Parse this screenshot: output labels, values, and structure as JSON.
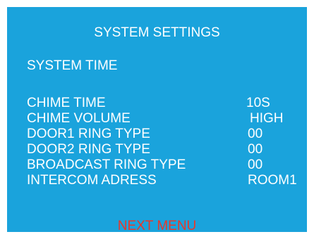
{
  "screen": {
    "title": "SYSTEM SETTINGS",
    "system_time_label": "SYSTEM TIME",
    "background_color": "#1aa3dc",
    "settings": [
      {
        "label": "CHIME TIME",
        "value": "10S"
      },
      {
        "label": "CHIME VOLUME",
        "value": "HIGH"
      },
      {
        "label": "DOOR1 RING TYPE",
        "value": "00"
      },
      {
        "label": "DOOR2 RING TYPE",
        "value": "00"
      },
      {
        "label": "BROADCAST RING TYPE",
        "value": "00"
      },
      {
        "label": "INTERCOM ADRESS",
        "value": "ROOM1"
      }
    ],
    "next_menu_label": "NEXT MENU",
    "next_menu_color": "#e8382a"
  }
}
